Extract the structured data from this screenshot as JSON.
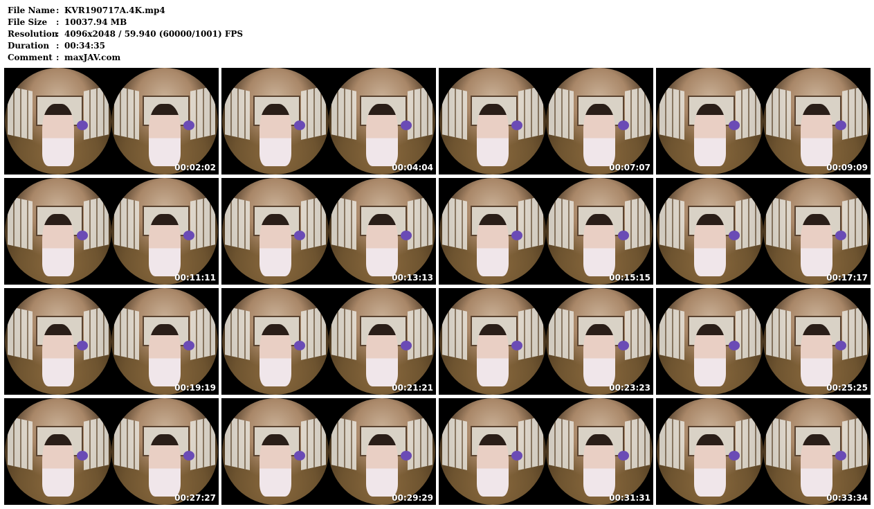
{
  "info": [
    {
      "label": "File Name",
      "sep": ":",
      "value": "KVR190717A.4K.mp4"
    },
    {
      "label": "File Size",
      "sep": ":",
      "value": "10037.94 MB"
    },
    {
      "label": "Resolution",
      "sep": ":",
      "value": "4096x2048 / 59.940 (60000/1001) FPS"
    },
    {
      "label": "Duration",
      "sep": ":",
      "value": "00:34:35"
    },
    {
      "label": "Comment",
      "sep": ":",
      "value": "maxJAV.com"
    }
  ],
  "thumbnails": [
    {
      "time": "00:02:02"
    },
    {
      "time": "00:04:04"
    },
    {
      "time": "00:07:07"
    },
    {
      "time": "00:09:09"
    },
    {
      "time": "00:11:11"
    },
    {
      "time": "00:13:13"
    },
    {
      "time": "00:15:15"
    },
    {
      "time": "00:17:17"
    },
    {
      "time": "00:19:19"
    },
    {
      "time": "00:21:21"
    },
    {
      "time": "00:23:23"
    },
    {
      "time": "00:25:25"
    },
    {
      "time": "00:27:27"
    },
    {
      "time": "00:29:29"
    },
    {
      "time": "00:31:31"
    },
    {
      "time": "00:33:34"
    }
  ]
}
